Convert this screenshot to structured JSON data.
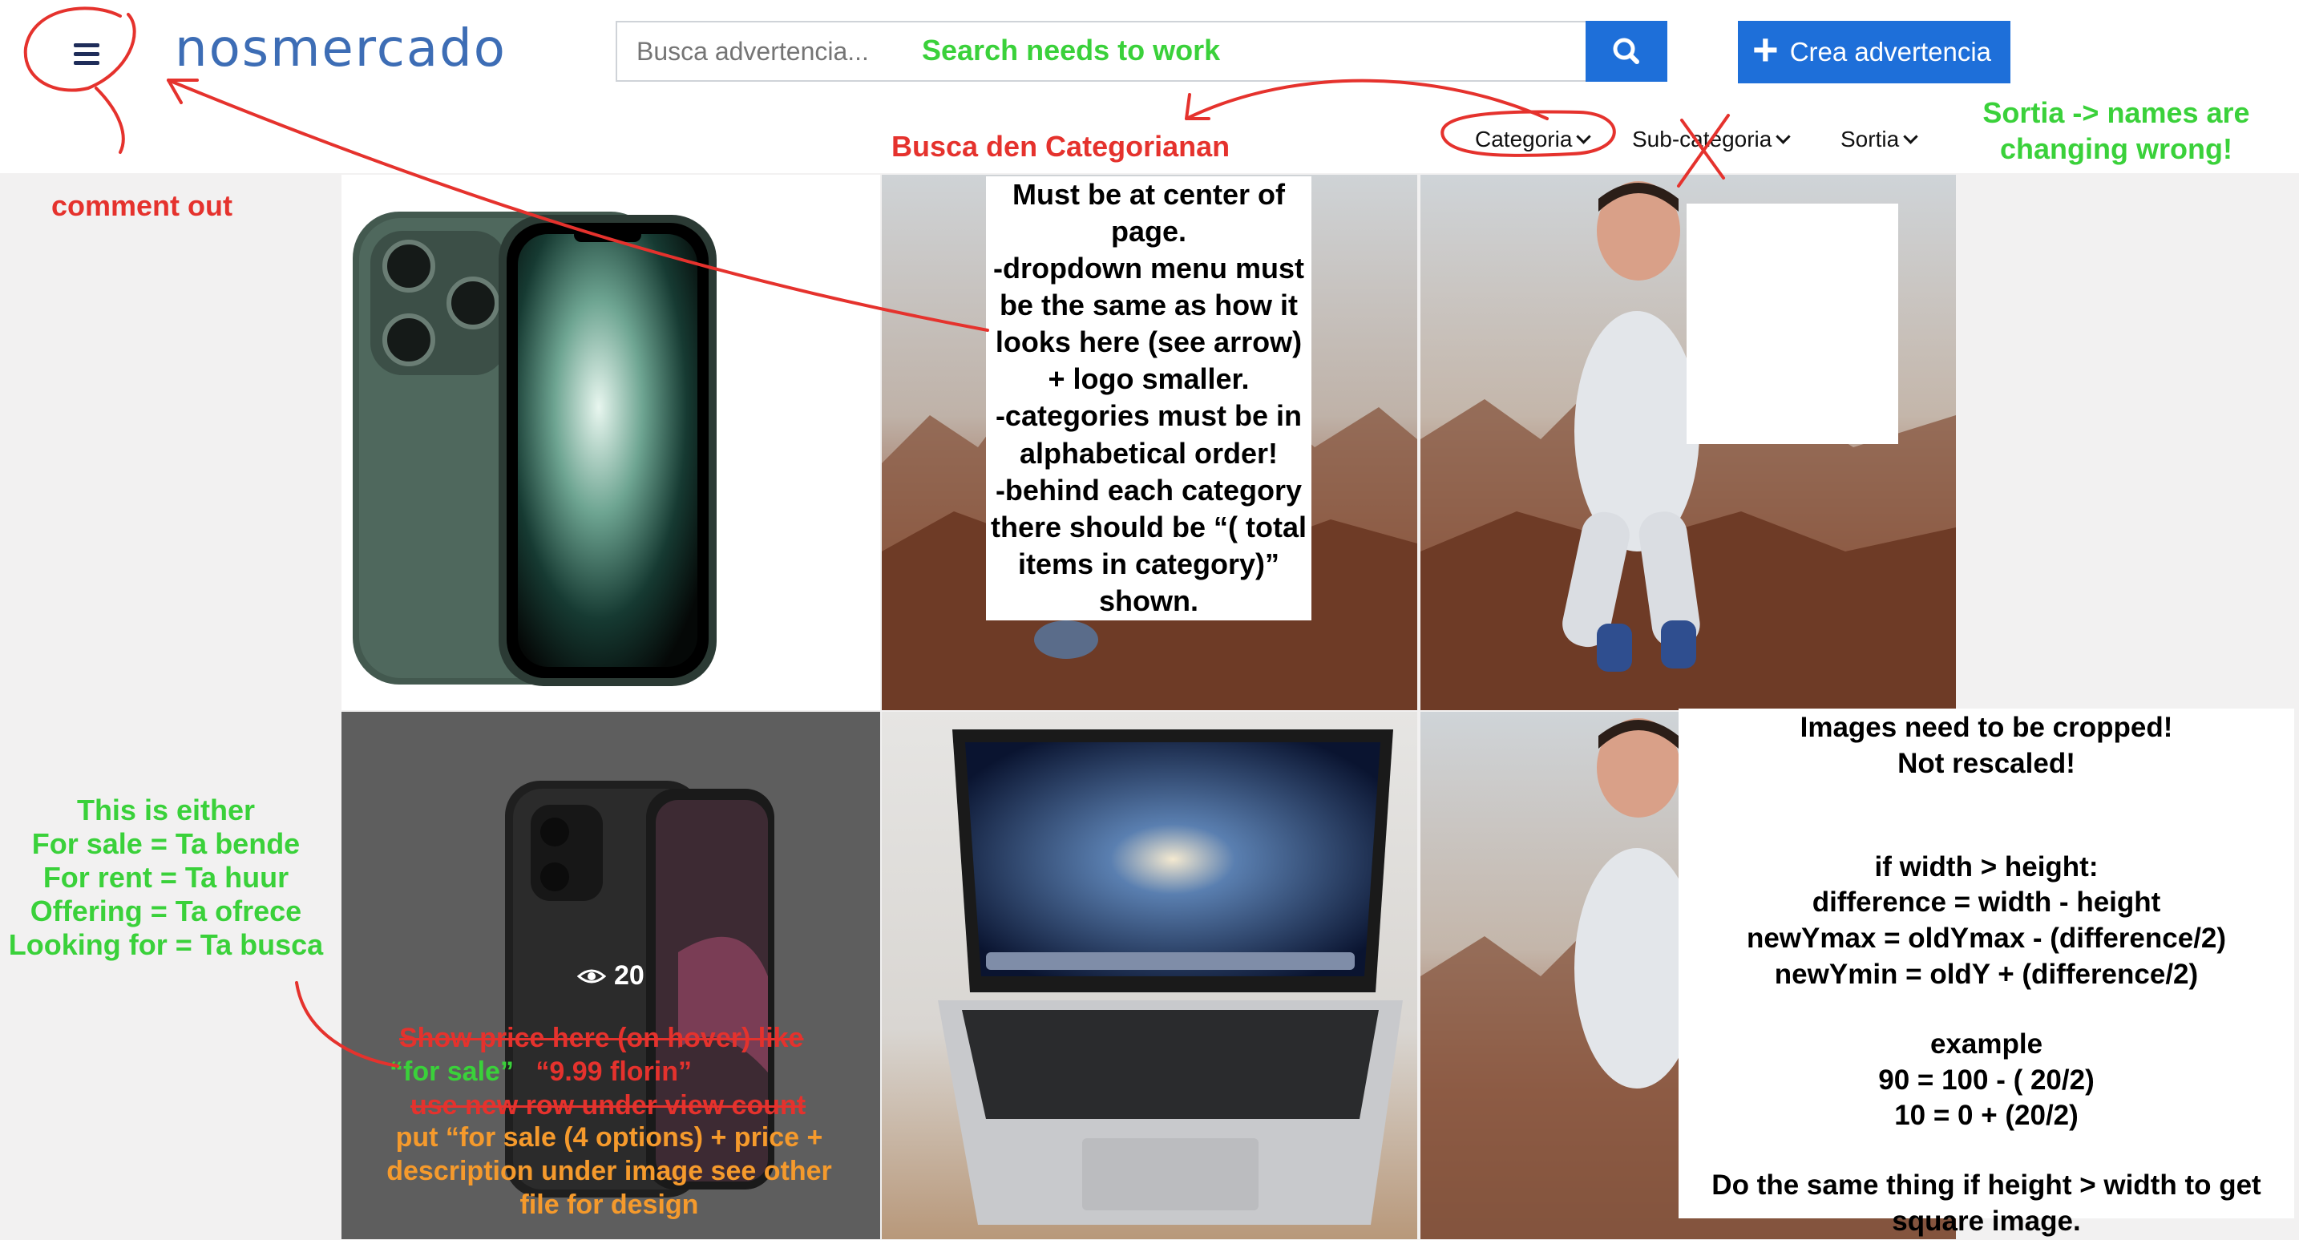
{
  "header": {
    "logo": "nosmercado",
    "search_placeholder": "Busca advertencia...",
    "create_label": "Crea advertencia",
    "nav": {
      "categoria": "Categoria",
      "sub_categoria": "Sub-categoria",
      "sortia": "Sortia"
    }
  },
  "tiles": {
    "views_count": "20"
  },
  "annotations": {
    "search_needs_work": "Search needs to work",
    "busca_den": "Busca den Categorianan",
    "sortia_names": "Sortia -> names are changing wrong!",
    "comment_out": "comment out",
    "center_note": [
      "Must be at center of",
      "page.",
      "-dropdown menu must",
      "be the same as how it",
      "looks here (see arrow)",
      "+ logo smaller.",
      "-categories must be in",
      "alphabetical order!",
      "-behind each category",
      "there should be “( total",
      "items in category)”",
      "shown."
    ],
    "listing_type": [
      "This is either",
      "For sale = Ta bende",
      "For rent = Ta huur",
      "Offering = Ta ofrece",
      "Looking for = Ta busca"
    ],
    "show_price_struck": "Show price here (on hover) like",
    "for_sale_example": "“for sale”",
    "price_example": "“9.99 florin”",
    "new_row_struck": "use new row under view count",
    "put_for_sale": [
      "put “for sale (4 options) + price +",
      "description under image see other",
      "file for design"
    ],
    "crop_note": [
      "Images need to be cropped!",
      "Not rescaled!",
      "",
      "",
      "if width > height:",
      "difference = width - height",
      "newYmax = oldYmax - (difference/2)",
      "newYmin = oldY + (difference/2)",
      "",
      "example",
      "90 = 100 - ( 20/2)",
      "10 = 0 + (20/2)",
      "",
      "Do the same thing if height > width to get",
      "square image."
    ]
  }
}
